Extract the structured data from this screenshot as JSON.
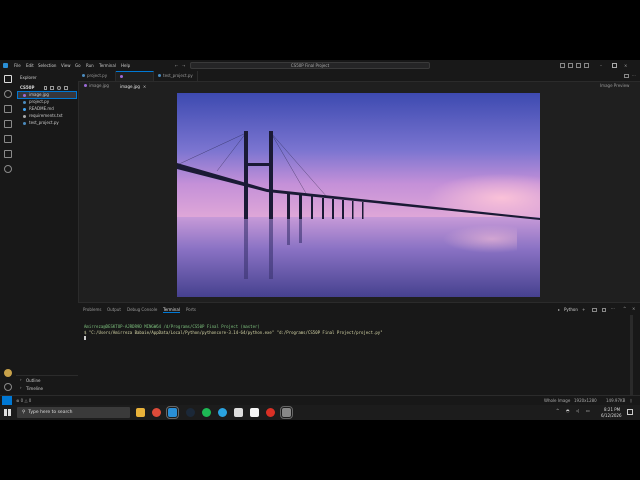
{
  "titlebar": {
    "menus": [
      "File",
      "Edit",
      "Selection",
      "View",
      "Go",
      "Run",
      "Terminal",
      "Help"
    ],
    "search_text": "CS50P Final Project"
  },
  "sidebar": {
    "header": "Explorer",
    "folder": "CS50P",
    "files": [
      "image.jpg",
      "project.py",
      "README.md",
      "requirements.txt",
      "test_project.py"
    ],
    "outline": "Outline",
    "timeline": "Timeline"
  },
  "editor": {
    "tabs": [
      "project.py",
      "image.jpg",
      "test_project.py"
    ],
    "breadcrumb": "image.jpg",
    "preview_label": "Image Preview"
  },
  "panel": {
    "tabs": [
      "Problems",
      "Output",
      "Debug Console",
      "Terminal",
      "Ports"
    ],
    "shell_label": "Python",
    "prompt": "Amirreza@DESKTOP-AJRDR9D MINGW64 /d/Programs/CS50P Final Project (master)",
    "command": "$ \"C:/Users/Amirreza Babaie/AppData/Local/Python/pythoncore-3.14-64/python.exe\" \"d:/Programs/CS50P Final Project/project.py\""
  },
  "statusbar": {
    "left": "⊗ 0 △ 0",
    "whole_image": "Whole Image",
    "dims": "1920x1280",
    "size": "149.97KB"
  },
  "taskbar": {
    "search_placeholder": "Type here to search",
    "time": "8:21 PM",
    "date": "6/12/2026"
  },
  "colors": {
    "accent": "#0078d4",
    "photo_top": "#4b57b8",
    "photo_mid": "#c98ad4",
    "photo_bottom": "#5b4a9a"
  }
}
